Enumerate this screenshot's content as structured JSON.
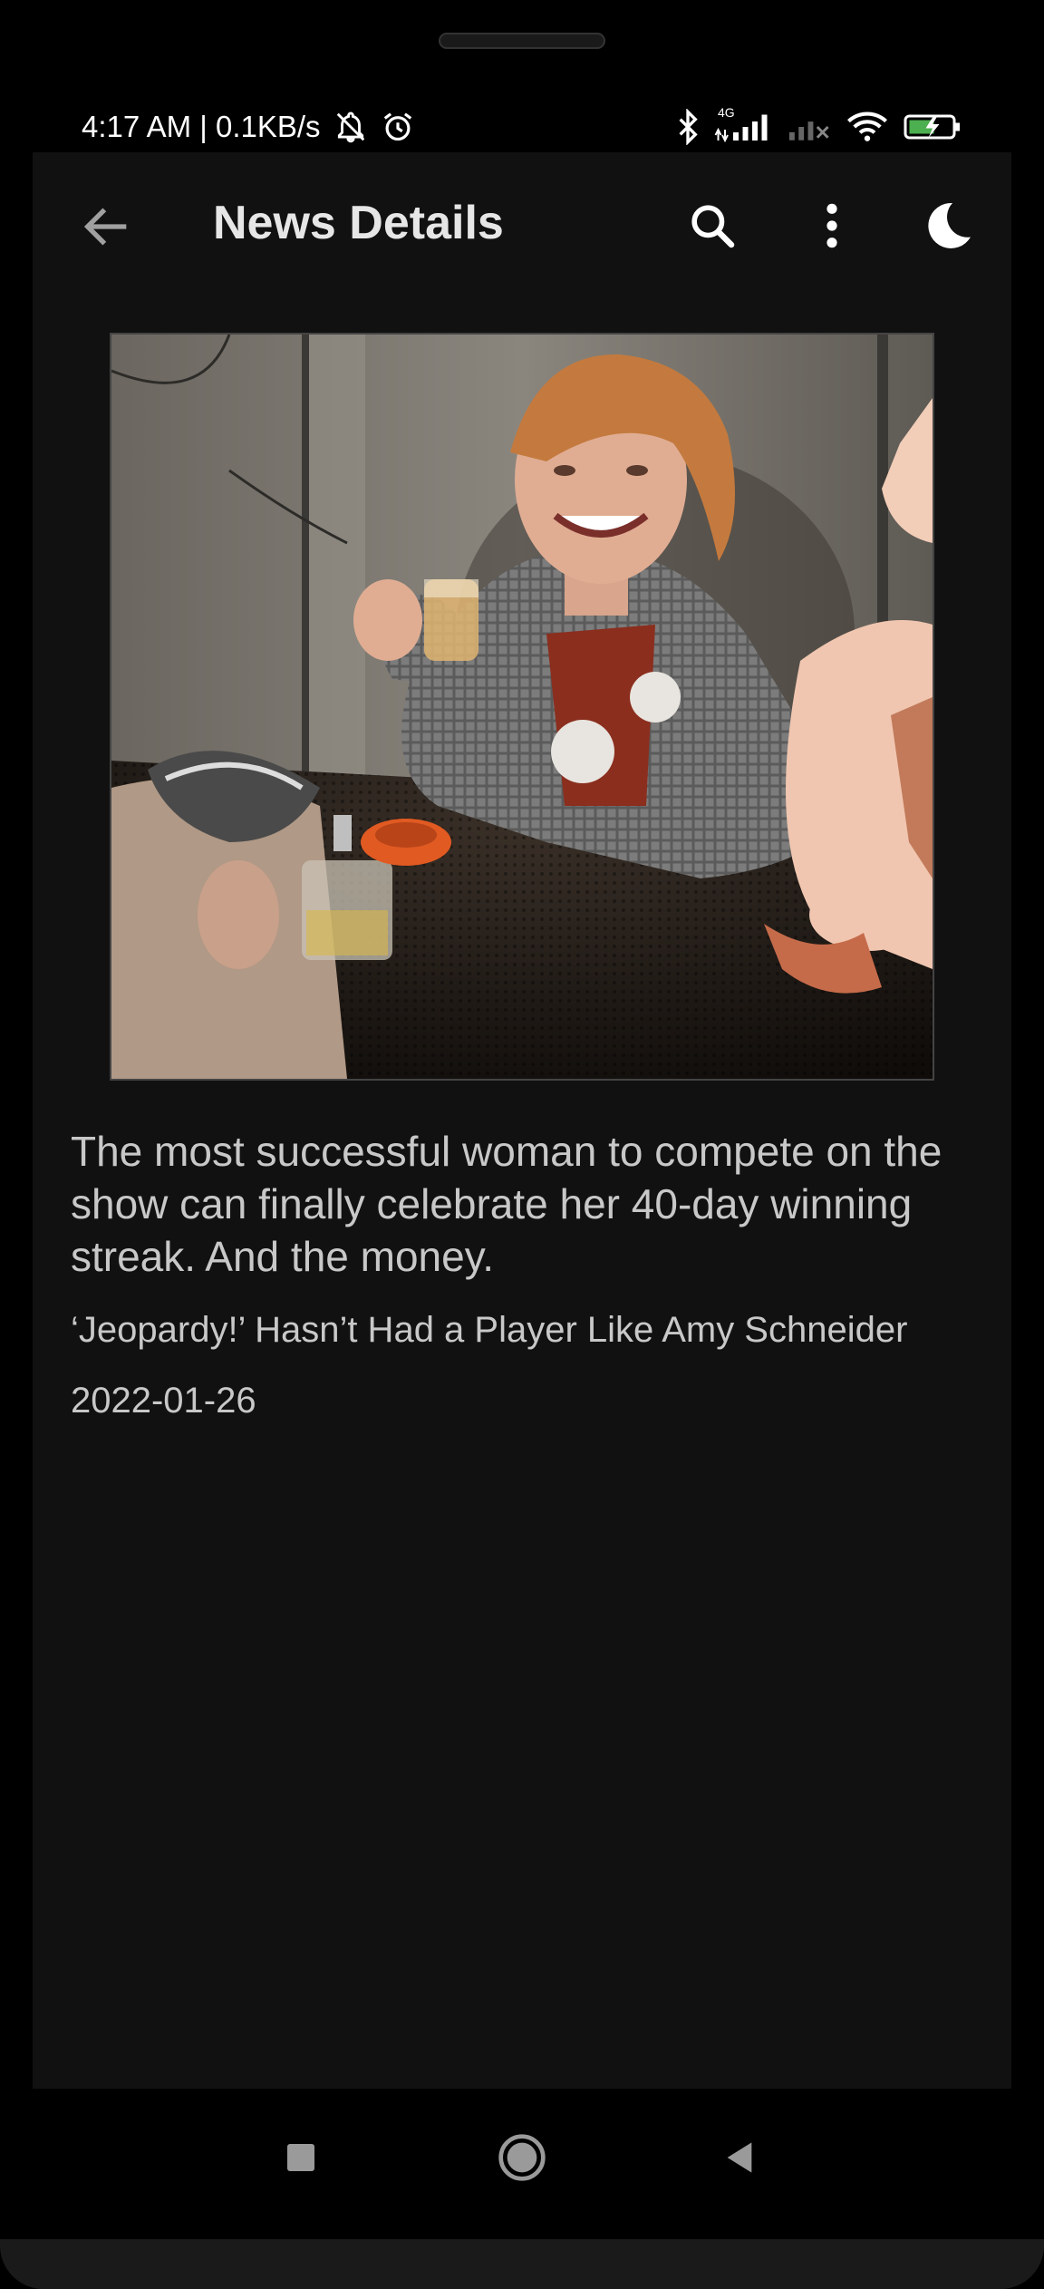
{
  "status": {
    "time_and_speed": "4:17 AM | 0.1KB/s",
    "network_label": "4G"
  },
  "appbar": {
    "title": "News Details"
  },
  "article": {
    "description": "The most successful woman to compete on the show can finally celebrate her 40-day winning streak. And the money.",
    "headline": "‘Jeopardy!’ Hasn’t Had a Player Like Amy Schneider",
    "date": "2022-01-26"
  },
  "colors": {
    "background": "#111111",
    "text": "#c8c8c8",
    "battery_charge": "#4caf50"
  },
  "icons": {
    "back": "arrow-left-icon",
    "search": "search-icon",
    "more": "more-vertical-icon",
    "theme": "moon-icon",
    "nav_recents": "square-icon",
    "nav_home": "circle-icon",
    "nav_back": "triangle-back-icon"
  }
}
